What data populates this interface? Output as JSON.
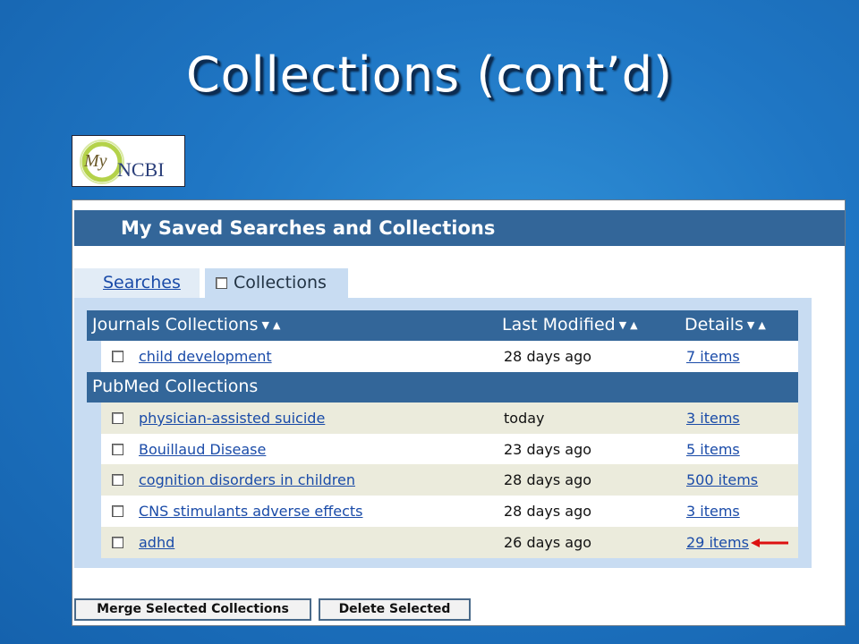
{
  "slide": {
    "title": "Collections (cont’d)"
  },
  "logo": {
    "my": "My",
    "ncbi": "NCBI"
  },
  "screenshot": {
    "header": "My Saved Searches and Collections",
    "tabs": [
      {
        "label": "Searches",
        "active": false
      },
      {
        "label": "Collections",
        "active": true
      }
    ],
    "columns": {
      "last_modified": "Last Modified",
      "details": "Details"
    },
    "sort_arrows": {
      "down": "▼",
      "up": "▲"
    },
    "groups": [
      {
        "title": "Journals Collections",
        "rows": [
          {
            "name": "child development",
            "modified": "28 days ago",
            "details": "7 items"
          }
        ]
      },
      {
        "title": "PubMed Collections",
        "rows": [
          {
            "name": "physician-assisted suicide",
            "modified": "today",
            "details": "3 items"
          },
          {
            "name": "Bouillaud Disease",
            "modified": "23 days ago",
            "details": "5 items"
          },
          {
            "name": "cognition disorders in children",
            "modified": "28 days ago",
            "details": "500 items"
          },
          {
            "name": "CNS stimulants adverse effects",
            "modified": "28 days ago",
            "details": "3 items"
          },
          {
            "name": "adhd",
            "modified": "26 days ago",
            "details": "29 items"
          }
        ]
      }
    ],
    "buttons": {
      "merge": "Merge Selected Collections",
      "delete": "Delete Selected"
    },
    "annotation_color": "#dd1111"
  }
}
